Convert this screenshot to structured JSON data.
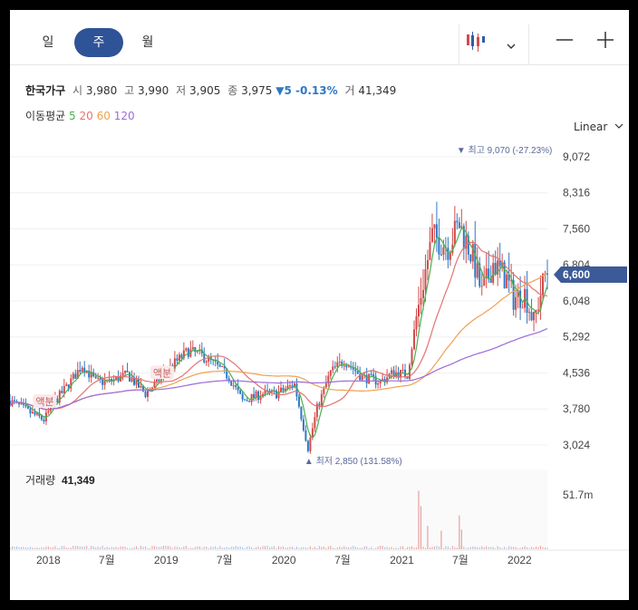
{
  "toolbar": {
    "periods": [
      "일",
      "주",
      "월"
    ],
    "active_period": "주",
    "chart_type_icon": "candlestick-icon",
    "zoom_out": "—",
    "zoom_in": "+"
  },
  "quote": {
    "name": "한국가구",
    "open_label": "시",
    "open": "3,980",
    "high_label": "고",
    "high": "3,990",
    "low_label": "저",
    "low": "3,905",
    "close_label": "종",
    "close": "3,975",
    "change": "▼5 -0.13%",
    "volume_label": "거",
    "volume": "41,349"
  },
  "moving_average": {
    "label": "이동평균",
    "periods": [
      "5",
      "20",
      "60",
      "120"
    ],
    "colors": [
      "#4caf50",
      "#e57373",
      "#f0a050",
      "#9c6ad8"
    ]
  },
  "scale_mode": "Linear",
  "chart_data": {
    "type": "candlestick",
    "y_ticks": [
      "9,072",
      "8,316",
      "7,560",
      "6,804",
      "6,048",
      "5,292",
      "4,536",
      "3,780",
      "3,024"
    ],
    "y_tick_values": [
      9072,
      8316,
      7560,
      6804,
      6048,
      5292,
      4536,
      3780,
      3024
    ],
    "ylim": [
      2700,
      9300
    ],
    "x_ticks": [
      "2018",
      "7월",
      "2019",
      "7월",
      "2020",
      "7월",
      "2021",
      "7월",
      "2022"
    ],
    "x_tick_dates": [
      "2018-01-01",
      "2018-07-01",
      "2019-01-01",
      "2019-07-01",
      "2020-01-01",
      "2020-07-01",
      "2021-01-01",
      "2021-07-01",
      "2022-01-01"
    ],
    "x_range": [
      "2017-09-04",
      "2022-03-28"
    ],
    "last_price": "6,600",
    "last_price_value": 6600,
    "high_marker": {
      "text": "최고 9,070 (-27.23%)",
      "date": "2021-06-28",
      "value": 9070
    },
    "low_marker": {
      "text": "최저 2,850 (131.58%)",
      "date": "2020-03-16",
      "value": 2850
    },
    "ex_dividend": [
      {
        "text": "액분",
        "date": "2017-12-18",
        "value": 3880
      },
      {
        "text": "액분",
        "date": "2018-12-17",
        "value": 4480
      }
    ],
    "weekly_close_profile": [
      [
        "2017-09-04",
        3950
      ],
      [
        "2017-11-06",
        3700
      ],
      [
        "2017-12-18",
        3550
      ],
      [
        "2018-01-15",
        3880
      ],
      [
        "2018-03-05",
        4300
      ],
      [
        "2018-04-16",
        4700
      ],
      [
        "2018-05-28",
        4350
      ],
      [
        "2018-07-09",
        4350
      ],
      [
        "2018-09-03",
        4500
      ],
      [
        "2018-10-29",
        4100
      ],
      [
        "2018-12-17",
        4450
      ],
      [
        "2019-01-21",
        4700
      ],
      [
        "2019-03-11",
        5000
      ],
      [
        "2019-04-22",
        4900
      ],
      [
        "2019-06-03",
        4700
      ],
      [
        "2019-07-15",
        4450
      ],
      [
        "2019-08-26",
        3950
      ],
      [
        "2019-10-28",
        4100
      ],
      [
        "2019-12-09",
        4100
      ],
      [
        "2020-02-03",
        4300
      ],
      [
        "2020-03-16",
        2950
      ],
      [
        "2020-04-13",
        3800
      ],
      [
        "2020-05-25",
        4550
      ],
      [
        "2020-07-06",
        4800
      ],
      [
        "2020-08-31",
        4450
      ],
      [
        "2020-10-26",
        4350
      ],
      [
        "2020-12-07",
        4550
      ],
      [
        "2021-01-18",
        4500
      ],
      [
        "2021-02-15",
        5700
      ],
      [
        "2021-04-05",
        7400
      ],
      [
        "2021-05-24",
        7200
      ],
      [
        "2021-06-28",
        7650
      ],
      [
        "2021-08-09",
        6950
      ],
      [
        "2021-09-06",
        6200
      ],
      [
        "2021-10-11",
        6850
      ],
      [
        "2021-11-22",
        6500
      ],
      [
        "2021-12-13",
        6100
      ],
      [
        "2022-01-17",
        6200
      ],
      [
        "2022-02-14",
        5600
      ],
      [
        "2022-03-21",
        6600
      ]
    ],
    "volume": {
      "label": "거래량",
      "value": "41,349",
      "axis_tick": "51.7m",
      "spikes": [
        [
          "2021-02-22",
          0.95
        ],
        [
          "2021-03-01",
          0.7
        ],
        [
          "2021-03-22",
          0.38
        ],
        [
          "2021-05-03",
          0.3
        ],
        [
          "2021-06-28",
          0.55
        ],
        [
          "2021-07-05",
          0.32
        ]
      ]
    }
  }
}
